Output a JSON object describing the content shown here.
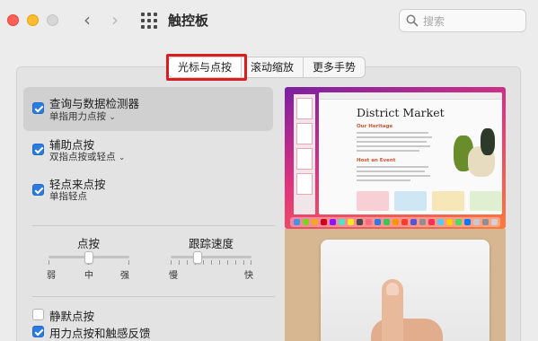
{
  "window": {
    "title": "触控板"
  },
  "search": {
    "placeholder": "搜索"
  },
  "tabs": [
    {
      "label": "光标与点按",
      "selected": true
    },
    {
      "label": "滚动缩放",
      "selected": false
    },
    {
      "label": "更多手势",
      "selected": false
    }
  ],
  "options": [
    {
      "label": "查询与数据检测器",
      "sub": "单指用力点按",
      "has_menu": true,
      "checked": true
    },
    {
      "label": "辅助点按",
      "sub": "双指点按或轻点",
      "has_menu": true,
      "checked": true
    },
    {
      "label": "轻点来点按",
      "sub": "单指轻点",
      "has_menu": false,
      "checked": true
    }
  ],
  "sliders": {
    "click": {
      "title": "点按",
      "labels": [
        "弱",
        "中",
        "强"
      ],
      "value": 0.5
    },
    "tracking": {
      "title": "跟踪速度",
      "labels": [
        "慢",
        "快"
      ],
      "value": 0.33
    }
  },
  "bottom_options": [
    {
      "label": "静默点按",
      "checked": false
    },
    {
      "label": "用力点按和触感反馈",
      "checked": true
    }
  ],
  "preview": {
    "doc_title": "District Market",
    "doc_heading_1": "Our Heritage",
    "doc_heading_2": "Host an Event"
  },
  "colors": {
    "accent": "#2c7be0",
    "highlight_box": "#d81e1e"
  }
}
